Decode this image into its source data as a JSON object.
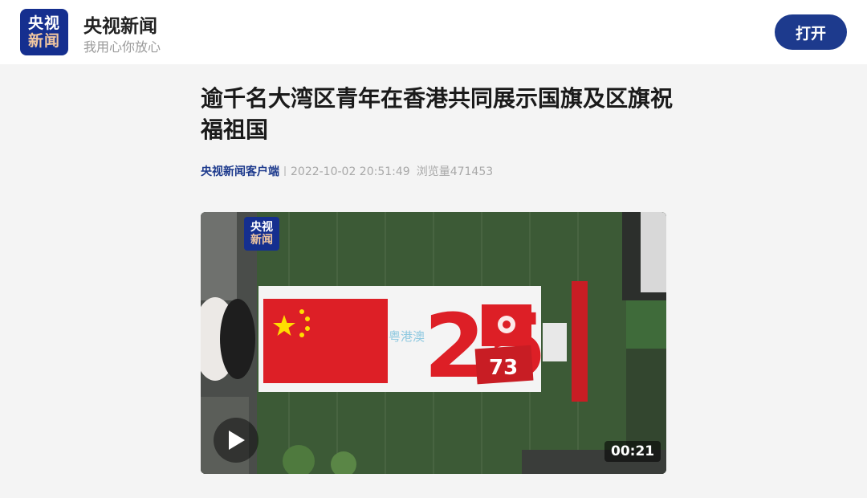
{
  "header": {
    "logo_line1": "央视",
    "logo_line2": "新闻",
    "app_name": "央视新闻",
    "slogan": "我用心你放心",
    "open_label": "打开"
  },
  "article": {
    "title": "逾千名大湾区青年在香港共同展示国旗及区旗祝福祖国",
    "source": "央视新闻客户端",
    "datetime": "2022-10-02 20:51:49",
    "views_label": "浏览量",
    "views": "471453"
  },
  "video": {
    "watermark_line1": "央视",
    "watermark_line2": "新闻",
    "duration": "00:21",
    "display_number": "25",
    "badge_number": "73",
    "banner_text": "粤港澳"
  },
  "icons": {
    "play": "play-icon"
  },
  "colors": {
    "brand_blue": "#1d3a8d",
    "flag_red": "#dd1f26",
    "flag_star": "#ffde00"
  }
}
